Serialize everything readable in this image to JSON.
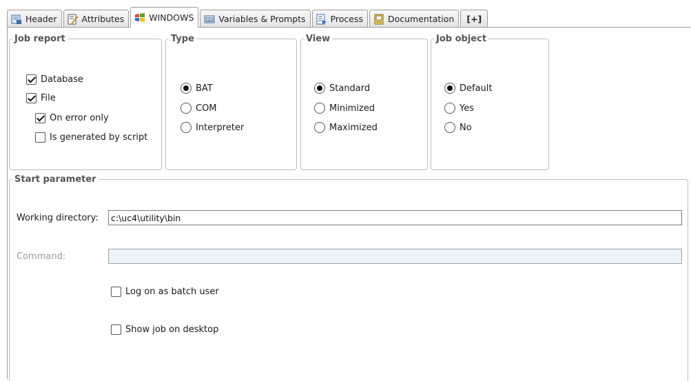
{
  "tabs": [
    {
      "label": "Header",
      "icon": "header-icon"
    },
    {
      "label": "Attributes",
      "icon": "attributes-icon"
    },
    {
      "label": "WINDOWS",
      "icon": "windows-icon",
      "active": true
    },
    {
      "label": "Variables & Prompts",
      "icon": "variables-icon"
    },
    {
      "label": "Process",
      "icon": "process-icon"
    },
    {
      "label": "Documentation",
      "icon": "documentation-icon"
    },
    {
      "label": "[+]",
      "icon": ""
    }
  ],
  "job_report": {
    "legend": "Job report",
    "database": {
      "label": "Database",
      "checked": true
    },
    "file": {
      "label": "File",
      "checked": true
    },
    "on_error_only": {
      "label": "On error only",
      "checked": true
    },
    "generated_by_script": {
      "label": "Is generated by script",
      "checked": false
    }
  },
  "type": {
    "legend": "Type",
    "options": [
      "BAT",
      "COM",
      "Interpreter"
    ],
    "selected": "BAT"
  },
  "view": {
    "legend": "View",
    "options": [
      "Standard",
      "Minimized",
      "Maximized"
    ],
    "selected": "Standard"
  },
  "job_object": {
    "legend": "Job object",
    "options": [
      "Default",
      "Yes",
      "No"
    ],
    "selected": "Default"
  },
  "start_parameter": {
    "legend": "Start parameter",
    "working_directory_label": "Working directory:",
    "working_directory_value": "c:\\uc4\\utility\\bin",
    "command_label": "Command:",
    "command_value": "",
    "log_on_batch_user": {
      "label": "Log on as batch user",
      "checked": false
    },
    "show_job_on_desktop": {
      "label": "Show job on desktop",
      "checked": false
    }
  }
}
